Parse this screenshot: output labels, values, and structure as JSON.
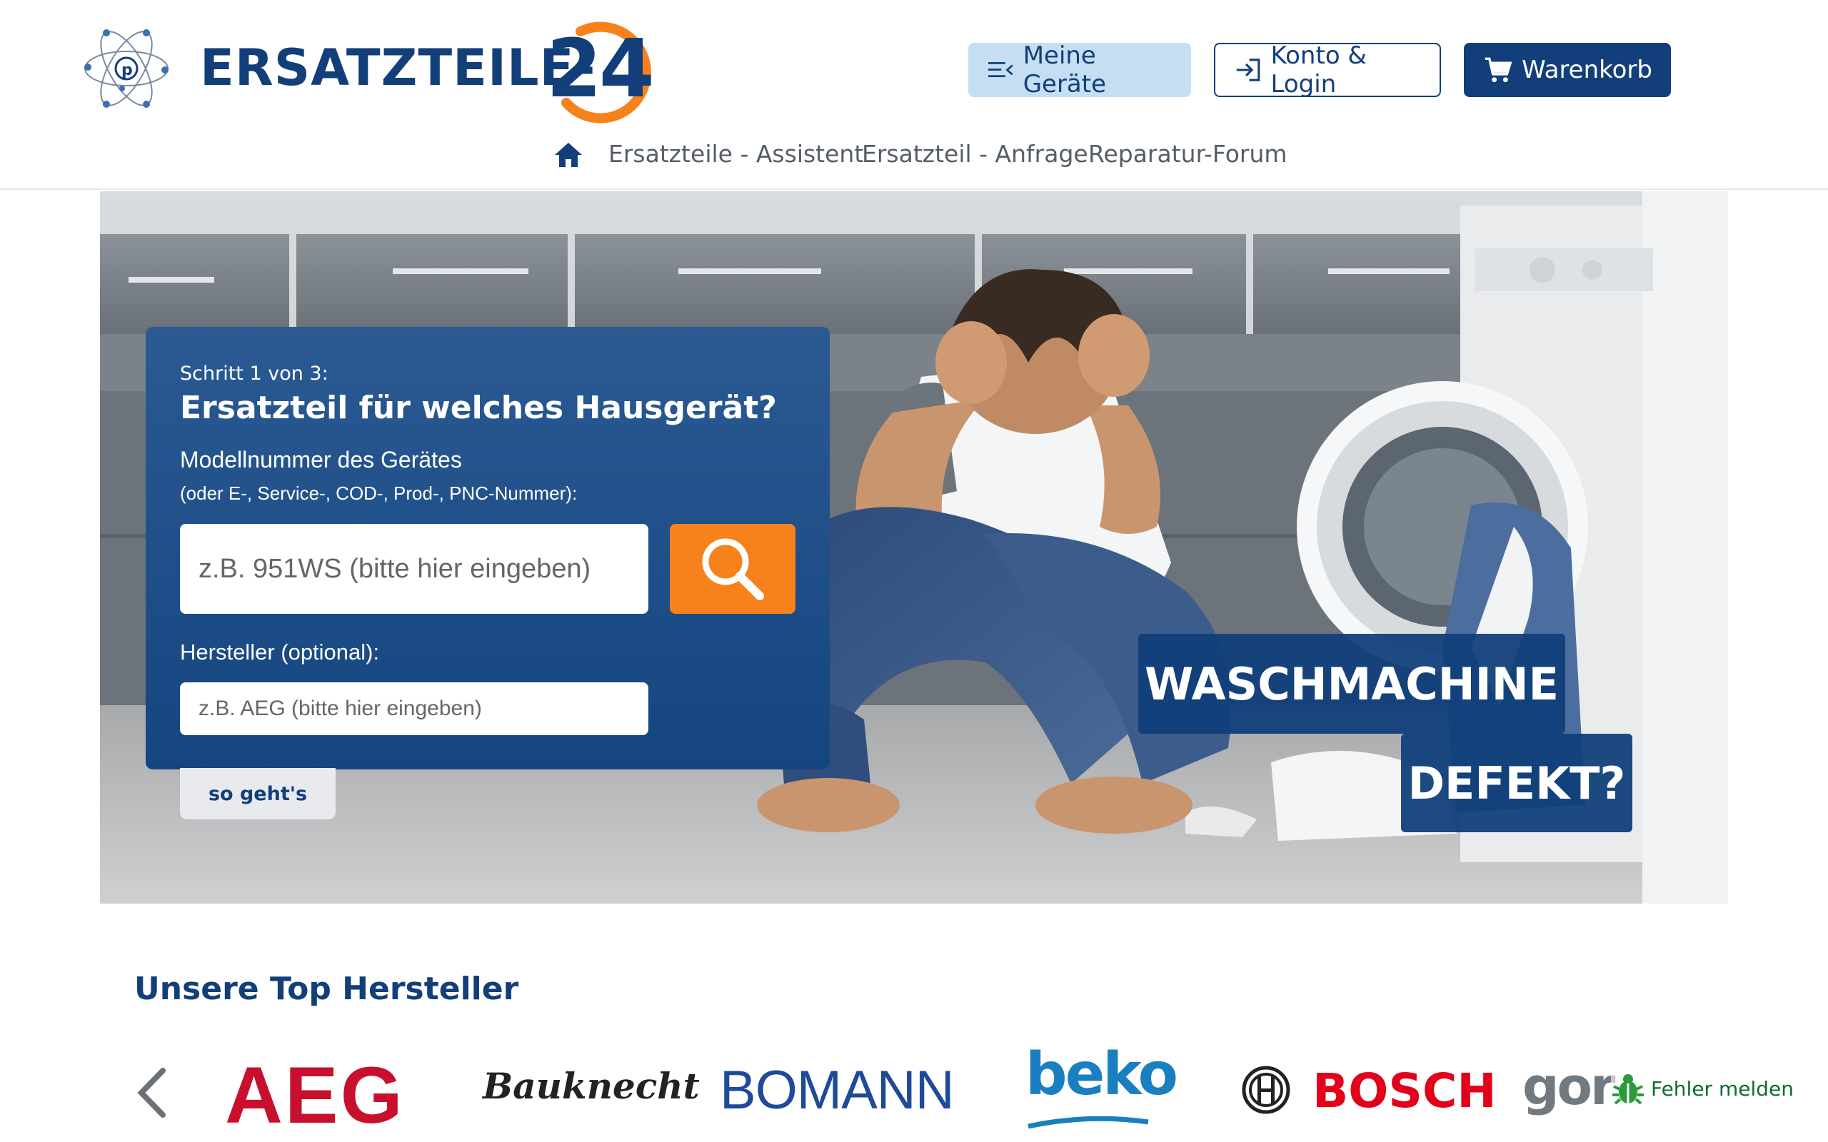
{
  "header": {
    "logo_text": "ERSATZTEILE-",
    "logo_number": "24",
    "buttons": {
      "geraete": "Meine Geräte",
      "konto": "Konto & Login",
      "warenkorb": "Warenkorb"
    }
  },
  "nav": {
    "items": [
      "Ersatzteile - Assistent",
      "Ersatzteil - Anfrage",
      "Reparatur-Forum"
    ]
  },
  "search": {
    "step": "Schritt 1 von 3:",
    "title": "Ersatzteil für welches Hausgerät?",
    "model_label": "Modellnummer des Gerätes",
    "model_sub": "(oder E-, Service-, COD-, Prod-, PNC-Nummer):",
    "model_placeholder": "z.B. 951WS (bitte hier eingeben)",
    "maker_label": "Hersteller (optional):",
    "maker_placeholder": "z.B. AEG (bitte hier eingeben)",
    "howto": "so geht's"
  },
  "hero": {
    "banner_line1": "WASCHMACHINE",
    "banner_line2": "DEFEKT?"
  },
  "brands_section": {
    "title": "Unsere Top Hersteller",
    "brands": [
      "AEG",
      "Bauknecht",
      "BOMANN",
      "beko",
      "BOSCH",
      "gor"
    ],
    "report": "Fehler melden"
  },
  "colors": {
    "primary": "#123f7a",
    "accent": "#f7821b",
    "light_button": "#c6def2"
  }
}
